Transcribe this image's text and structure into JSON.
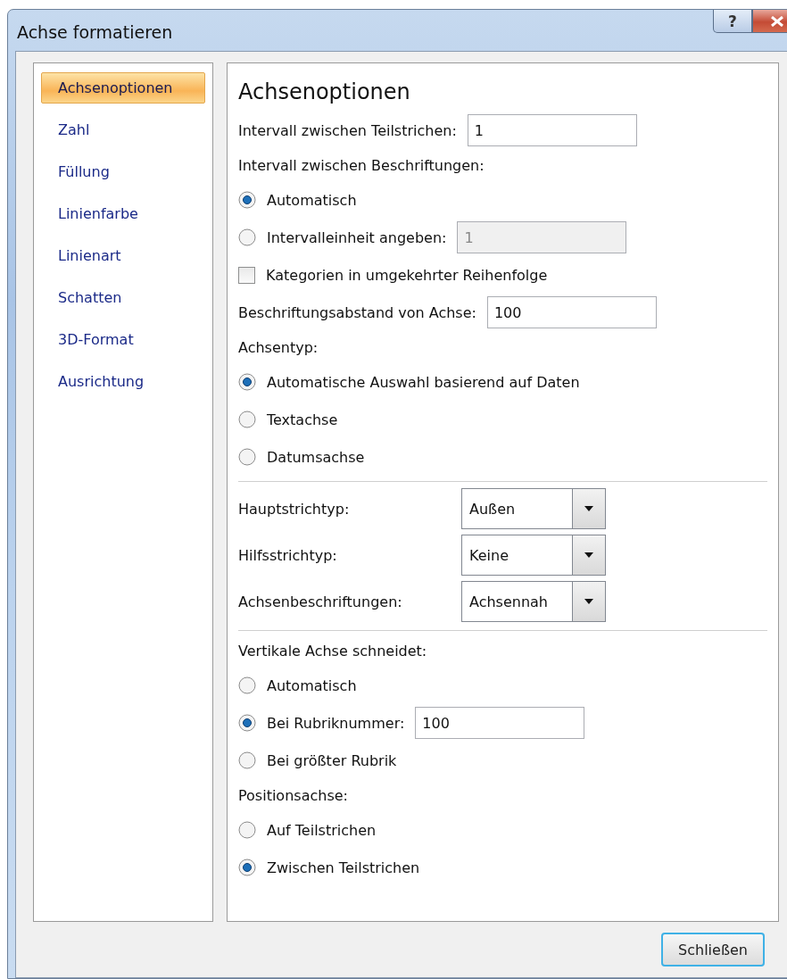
{
  "window": {
    "title": "Achse formatieren",
    "title_buttons": [
      {
        "kind": "help",
        "label": "?"
      },
      {
        "kind": "close"
      }
    ]
  },
  "sidebar": {
    "items": [
      {
        "label": "Achsenoptionen",
        "selected": true
      },
      {
        "label": "Zahl",
        "selected": false
      },
      {
        "label": "Füllung",
        "selected": false
      },
      {
        "label": "Linienfarbe",
        "selected": false
      },
      {
        "label": "Linienart",
        "selected": false
      },
      {
        "label": "Schatten",
        "selected": false
      },
      {
        "label": "3D-Format",
        "selected": false
      },
      {
        "label": "Ausrichtung",
        "selected": false
      }
    ]
  },
  "panel": {
    "title": "Achsenoptionen",
    "rows": [
      {
        "kind": "field",
        "label": "Intervall zwischen Teilstrichen:",
        "value": "1",
        "disabled": false
      },
      {
        "kind": "label",
        "label": "Intervall zwischen Beschriftungen:"
      },
      {
        "kind": "radio",
        "label": "Automatisch",
        "selected": true
      },
      {
        "kind": "radio",
        "label": "Intervalleinheit angeben:",
        "selected": false,
        "field": {
          "value": "1",
          "disabled": true
        }
      },
      {
        "kind": "checkbox",
        "label": "Kategorien in umgekehrter Reihenfolge",
        "checked": false
      },
      {
        "kind": "field",
        "label": "Beschriftungsabstand von Achse:",
        "value": "100",
        "disabled": false
      },
      {
        "kind": "label",
        "label": "Achsentyp:"
      },
      {
        "kind": "radio",
        "label": "Automatische Auswahl basierend auf Daten",
        "selected": true
      },
      {
        "kind": "radio",
        "label": "Textachse",
        "selected": false
      },
      {
        "kind": "radio",
        "label": "Datumsachse",
        "selected": false
      },
      {
        "kind": "separator"
      },
      {
        "kind": "select",
        "label": "Hauptstrichtyp:",
        "value": "Außen"
      },
      {
        "kind": "select",
        "label": "Hilfsstrichtyp:",
        "value": "Keine"
      },
      {
        "kind": "select",
        "label": "Achsenbeschriftungen:",
        "value": "Achsennah"
      },
      {
        "kind": "separator"
      },
      {
        "kind": "label",
        "label": "Vertikale Achse schneidet:"
      },
      {
        "kind": "radio",
        "label": "Automatisch",
        "selected": false
      },
      {
        "kind": "radio",
        "label": "Bei Rubriknummer:",
        "selected": true,
        "field": {
          "value": "100",
          "disabled": false
        }
      },
      {
        "kind": "radio",
        "label": "Bei größter Rubrik",
        "selected": false
      },
      {
        "kind": "label",
        "label": "Positionsachse:"
      },
      {
        "kind": "radio",
        "label": "Auf Teilstrichen",
        "selected": false
      },
      {
        "kind": "radio",
        "label": "Zwischen Teilstrichen",
        "selected": true
      }
    ]
  },
  "buttons": [
    "Schließen"
  ]
}
